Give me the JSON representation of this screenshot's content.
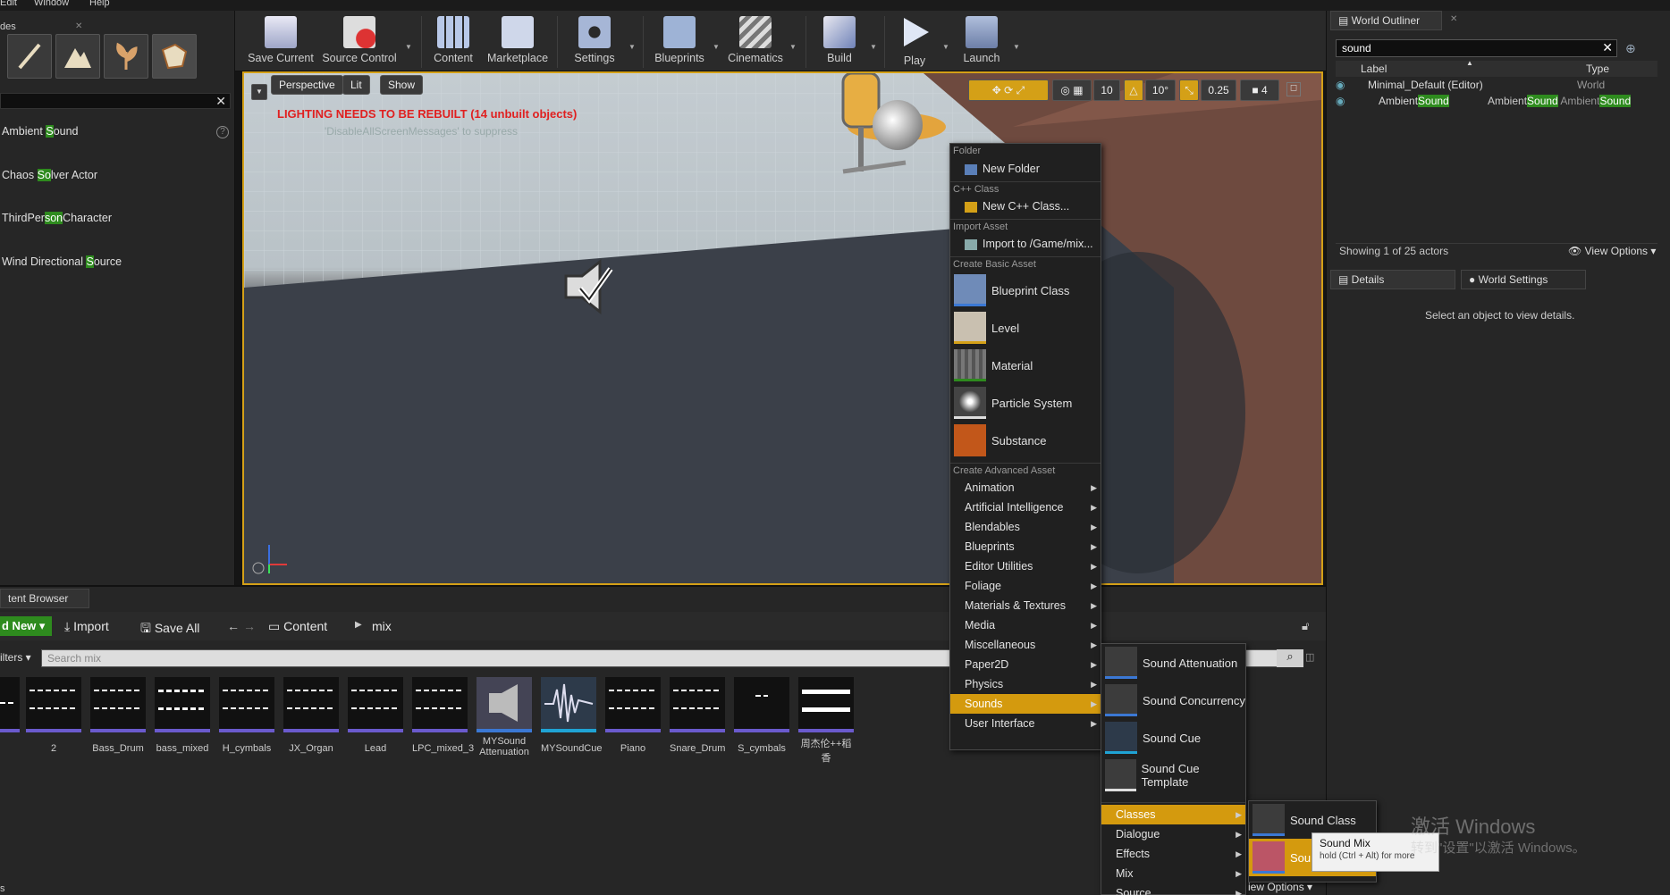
{
  "menubar": {
    "edit": "Edit",
    "window": "Window",
    "help": "Help"
  },
  "modes": {
    "tab_label": "des",
    "search_value": "",
    "items": [
      {
        "pre": "Ambient ",
        "hl": "S",
        "post": "ound"
      },
      {
        "pre": "Chaos ",
        "hl": "So",
        "post": "lver Actor"
      },
      {
        "pre": "ThirdPer",
        "hl": "son",
        "post": "Character"
      },
      {
        "pre": "Wind Directional ",
        "hl": "S",
        "post": "ource"
      }
    ]
  },
  "toolbar": {
    "save_current": "Save Current",
    "source_control": "Source Control",
    "content": "Content",
    "marketplace": "Marketplace",
    "settings": "Settings",
    "blueprints": "Blueprints",
    "cinematics": "Cinematics",
    "build": "Build",
    "play": "Play",
    "launch": "Launch"
  },
  "viewport": {
    "perspective": "Perspective",
    "lit": "Lit",
    "show": "Show",
    "warning": "LIGHTING NEEDS TO BE REBUILT (14 unbuilt objects)",
    "suppress": "'DisableAllScreenMessages' to suppress",
    "grid_value": "10",
    "angle_value": "10°",
    "scale_value": "0.25",
    "camera_speed": "4"
  },
  "outliner": {
    "tab": "World Outliner",
    "search_value": "sound",
    "col_label": "Label",
    "col_type": "Type",
    "rows": [
      {
        "label": "Minimal_Default (Editor)",
        "type": "World"
      },
      {
        "label_pre": "Ambient",
        "label_hl": "Sound",
        "type_pre": "Ambient",
        "type_hl": "Sound",
        "type_pre2": " Ambient",
        "type_hl2": "Sound"
      }
    ],
    "showing": "Showing 1 of 25 actors",
    "view_options": "View Options"
  },
  "details": {
    "tab_details": "Details",
    "tab_world_settings": "World Settings",
    "empty_message": "Select an object to view details."
  },
  "content_browser": {
    "tab": "tent Browser",
    "add_new": "d New",
    "import": "Import",
    "save_all": "Save All",
    "path_root": "Content",
    "path_folder": "mix",
    "filters": "ilters",
    "search_placeholder": "Search mix",
    "bottom_left": "s",
    "view_options": "iew Options",
    "assets": [
      {
        "name": "2"
      },
      {
        "name": "Bass_Drum"
      },
      {
        "name": "bass_mixed"
      },
      {
        "name": "H_cymbals"
      },
      {
        "name": "JX_Organ"
      },
      {
        "name": "Lead"
      },
      {
        "name": "LPC_mixed_3"
      },
      {
        "name": "MYSound Attenuation"
      },
      {
        "name": "MYSoundCue"
      },
      {
        "name": "Piano"
      },
      {
        "name": "Snare_Drum"
      },
      {
        "name": "S_cymbals"
      },
      {
        "name": "周杰伦++稻香"
      }
    ]
  },
  "context_menu": {
    "sec_folder": "Folder",
    "new_folder": "New Folder",
    "sec_cpp": "C++ Class",
    "new_cpp": "New C++ Class...",
    "sec_import": "Import Asset",
    "import_to": "Import to /Game/mix...",
    "sec_basic": "Create Basic Asset",
    "basic": [
      "Blueprint Class",
      "Level",
      "Material",
      "Particle System",
      "Substance"
    ],
    "sec_advanced": "Create Advanced Asset",
    "advanced": [
      "Animation",
      "Artificial Intelligence",
      "Blendables",
      "Blueprints",
      "Editor Utilities",
      "Foliage",
      "Materials & Textures",
      "Media",
      "Miscellaneous",
      "Paper2D",
      "Physics",
      "Sounds",
      "User Interface"
    ]
  },
  "sounds_menu": {
    "big": [
      "Sound Attenuation",
      "Sound Concurrency",
      "Sound Cue",
      "Sound Cue Template"
    ],
    "sub": [
      "Classes",
      "Dialogue",
      "Effects",
      "Mix",
      "Source"
    ]
  },
  "classes_menu": {
    "sound_class": "Sound Class",
    "sound_mix_partial": "Sou"
  },
  "tooltip": {
    "title": "Sound Mix",
    "hint": "hold (Ctrl + Alt) for more"
  },
  "watermark": {
    "line1": "激活 Windows",
    "line2": "转到\"设置\"以激活 Windows。"
  }
}
